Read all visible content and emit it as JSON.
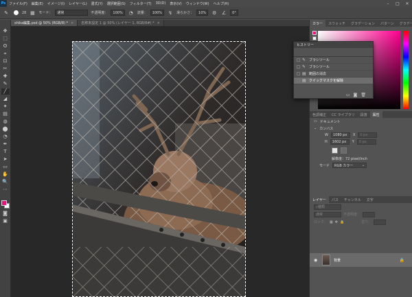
{
  "app": {
    "logo": "Ps"
  },
  "menu": [
    "ファイル(F)",
    "編集(E)",
    "イメージ(I)",
    "レイヤー(L)",
    "書式(Y)",
    "選択範囲(S)",
    "フィルター(T)",
    "3D(D)",
    "表示(V)",
    "ウィンドウ(W)",
    "ヘルプ(H)"
  ],
  "window_controls": [
    "–",
    "□",
    "✕"
  ],
  "options": {
    "brush_size": "28",
    "mode_label": "モード：",
    "mode_value": "通常",
    "opacity_label": "不透明度：",
    "opacity_value": "100%",
    "flow_label": "流量：",
    "flow_value": "100%",
    "smooth_label": "滑らかさ：",
    "smooth_value": "10%",
    "angle_value": "0°"
  },
  "tabs": [
    {
      "label": "shika編集.psd @ 50% (RGB/8) *",
      "active": true
    },
    {
      "label": "名称未設定 1 @ 50% (レイヤー 1, RGB/8#) *",
      "active": false
    }
  ],
  "tools": [
    "✥",
    "⬚",
    "ʘ",
    "⌖",
    "⊡",
    "✂",
    "✚",
    "✎",
    "╱",
    "◢",
    "✦",
    "▤",
    "◍",
    "⬤",
    "◔",
    "✒",
    "T",
    "➤",
    "▭",
    "✋",
    "🔍",
    "⋯"
  ],
  "history": {
    "title": "ヒストリー",
    "items": [
      {
        "label": "ブラシツール",
        "icon": "brush-icon",
        "selected": false
      },
      {
        "label": "ブラシツール",
        "icon": "brush-icon",
        "selected": false
      },
      {
        "label": "範囲の消去",
        "icon": "doc-icon",
        "selected": false
      },
      {
        "label": "クイックマスクを解除",
        "icon": "doc-icon",
        "selected": true
      }
    ]
  },
  "color_panel": {
    "tabs": [
      "カラー",
      "スウォッチ",
      "グラデーション",
      "パターン",
      "グラデーション"
    ],
    "fg_color": "#e8127e",
    "bg_color": "#ffffff"
  },
  "props_panel": {
    "tabs": [
      "色調補正",
      "CC ライブラリ",
      "段落",
      "属性"
    ],
    "section_doc": "ドキュメント",
    "section_canvas": "カンバス",
    "w_label": "W",
    "w_value": "1080 px",
    "h_label": "H",
    "h_value": "1602 px",
    "x_label": "X",
    "y_label": "Y",
    "x_value": "0 px",
    "y_value": "0 px",
    "resolution": "解像度：72 pixel/inch",
    "mode_label": "モード",
    "mode_value": "RGB カラー"
  },
  "layers_panel": {
    "tabs": [
      "レイヤー",
      "パス",
      "チャンネル",
      "文字"
    ],
    "search_placeholder": "種類",
    "blend_label": "通常",
    "opacity_label": "不透明度：",
    "lock_label": "ロック：",
    "fill_label": "塗り：",
    "layer_name": "背景"
  }
}
